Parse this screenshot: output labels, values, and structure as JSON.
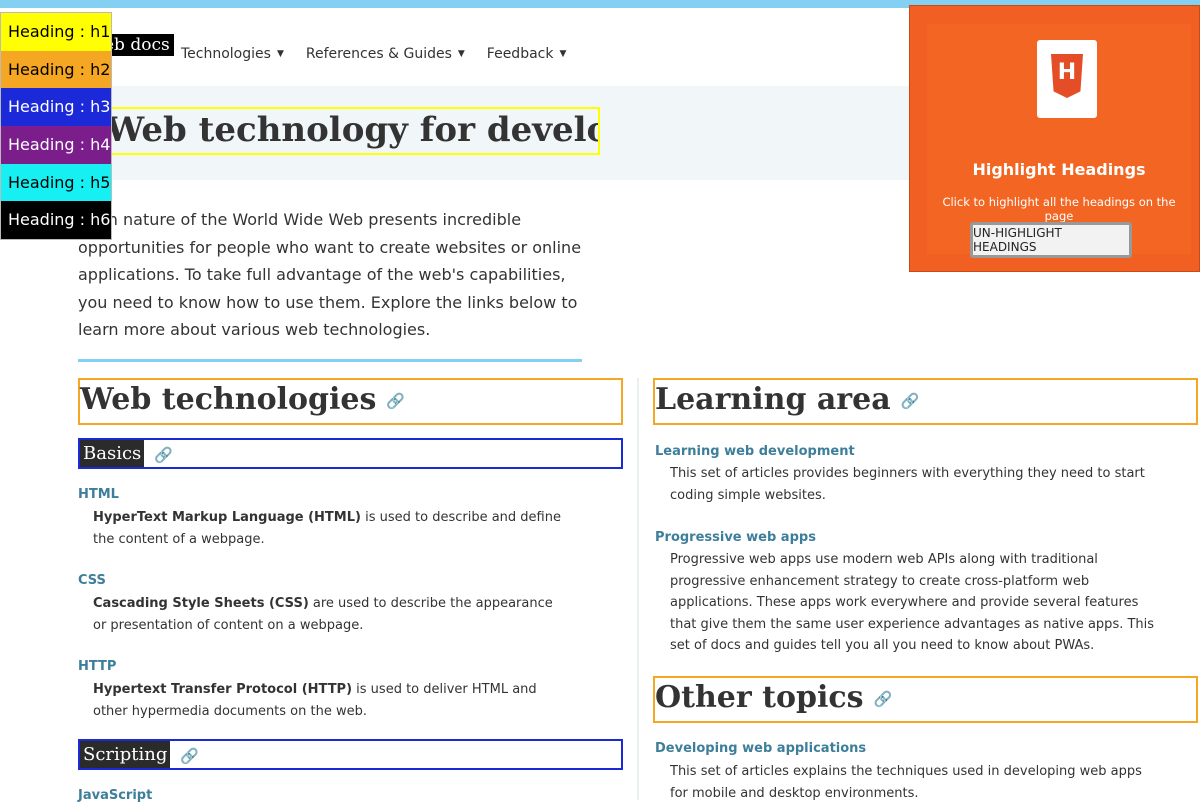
{
  "header": {
    "brand": "eb docs",
    "nav": [
      {
        "label": "Technologies"
      },
      {
        "label": "References & Guides"
      },
      {
        "label": "Feedback"
      }
    ]
  },
  "hero": {
    "title": "Web technology for developers"
  },
  "intro": "open nature of the World Wide Web presents incredible opportunities for people who want to create websites or online applications. To take full advantage of the web's capabilities, you need to know how to use them. Explore the links below to learn more about various web technologies.",
  "left": {
    "heading": "Web technologies",
    "basics": "Basics",
    "items": [
      {
        "term": "HTML",
        "bold": "HyperText Markup Language (HTML)",
        "rest": " is used to describe and define the content of a webpage."
      },
      {
        "term": "CSS",
        "bold": "Cascading Style Sheets (CSS)",
        "rest": " are used to describe the appearance or presentation of content on a webpage."
      },
      {
        "term": "HTTP",
        "bold": "Hypertext Transfer Protocol (HTTP)",
        "rest": " is used to deliver HTML and other hypermedia documents on the web."
      }
    ],
    "scripting": "Scripting",
    "last_term": "JavaScript"
  },
  "right": {
    "heading": "Learning area",
    "items": [
      {
        "term": "Learning web development",
        "desc": "This set of articles provides beginners with everything they need to start coding simple websites."
      },
      {
        "term": "Progressive web apps",
        "desc": "Progressive web apps use modern web APIs along with traditional progressive enhancement strategy to create cross-platform web applications. These apps work everywhere and provide several features that give them the same user experience advantages as native apps. This set of docs and guides tell you all you need to know about PWAs."
      }
    ],
    "heading2": "Other topics",
    "other": {
      "term": "Developing web applications",
      "desc": "This set of articles explains the techniques used in developing web apps for mobile and desktop environments."
    }
  },
  "extension": {
    "logo_letter": "H",
    "title": "Highlight Headings",
    "subtitle": "Click to highlight all the headings on the page",
    "button": "UN-HIGHLIGHT HEADINGS"
  },
  "legend": [
    {
      "label": "Heading : h1",
      "bg": "#ffff00",
      "fg": "#000000"
    },
    {
      "label": "Heading : h2",
      "bg": "#f5a623",
      "fg": "#000000"
    },
    {
      "label": "Heading : h3",
      "bg": "#1c29d9",
      "fg": "#ffffff"
    },
    {
      "label": "Heading : h4",
      "bg": "#7b1e8c",
      "fg": "#ffffff"
    },
    {
      "label": "Heading : h5",
      "bg": "#16f0f2",
      "fg": "#000000"
    },
    {
      "label": "Heading : h6",
      "bg": "#000000",
      "fg": "#ffffff"
    }
  ],
  "colors": {
    "accent": "#83d0f2",
    "link": "#3d7e9a",
    "panel": "#f15f22"
  },
  "icons": {
    "link": "link-icon",
    "caret": "caret-down-icon",
    "logo": "html5-shield-icon"
  }
}
